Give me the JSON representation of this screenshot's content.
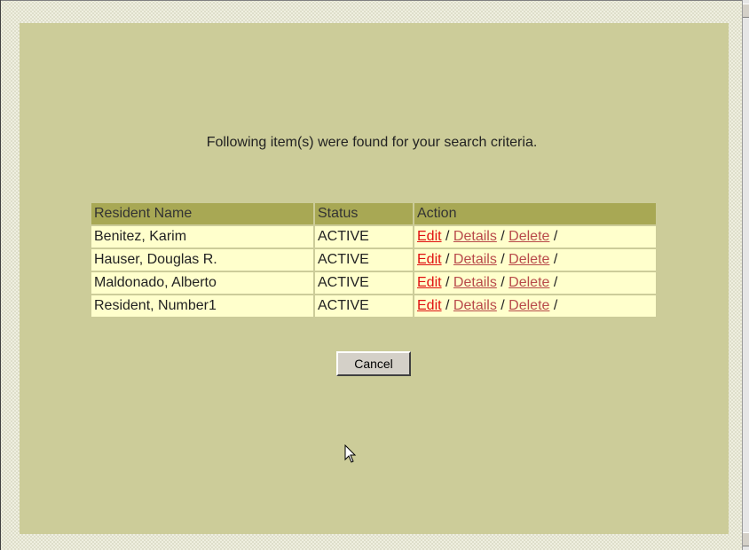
{
  "message": "Following item(s) were found for your search criteria.",
  "table": {
    "headers": [
      "Resident Name",
      "Status",
      "Action"
    ],
    "rows": [
      {
        "name": "Benitez, Karim",
        "status": "ACTIVE"
      },
      {
        "name": "Hauser, Douglas R.",
        "status": "ACTIVE"
      },
      {
        "name": "Maldonado, Alberto",
        "status": "ACTIVE"
      },
      {
        "name": "Resident, Number1",
        "status": "ACTIVE"
      }
    ],
    "actions": {
      "edit": "Edit",
      "details": "Details",
      "delete": "Delete",
      "separator": " / "
    }
  },
  "cancel_label": "Cancel",
  "colors": {
    "panel": "#cccc99",
    "header": "#a8a854",
    "row": "#ffffcc",
    "edit_link": "#e01010",
    "link": "#b84a4a"
  },
  "icons": [
    "arrow-cursor-icon"
  ]
}
